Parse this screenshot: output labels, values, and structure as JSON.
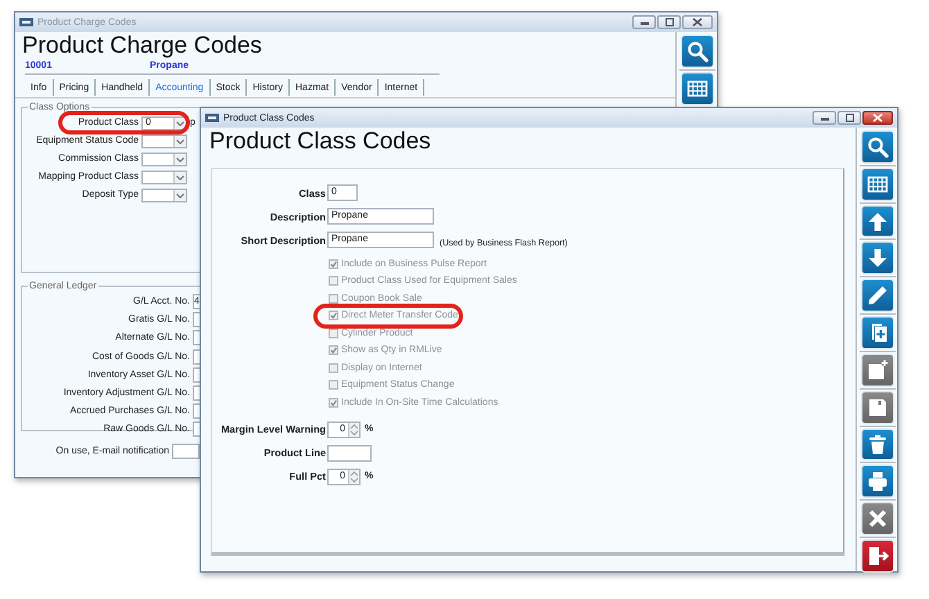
{
  "charge_window": {
    "title": "Product Charge Codes",
    "active": false,
    "heading": "Product Charge Codes",
    "code": "10001",
    "name": "Propane",
    "tabs": [
      {
        "label": "Info",
        "selected": false
      },
      {
        "label": "Pricing",
        "selected": false
      },
      {
        "label": "Handheld",
        "selected": false
      },
      {
        "label": "Accounting",
        "selected": true
      },
      {
        "label": "Stock",
        "selected": false
      },
      {
        "label": "History",
        "selected": false
      },
      {
        "label": "Hazmat",
        "selected": false
      },
      {
        "label": "Vendor",
        "selected": false
      },
      {
        "label": "Internet",
        "selected": false
      }
    ],
    "class_options": {
      "title": "Class Options",
      "fields": [
        {
          "label": "Product Class",
          "value": "0",
          "note": "p",
          "highlighted": true
        },
        {
          "label": "Equipment Status Code",
          "highlighted": false
        },
        {
          "label": "Commission Class",
          "highlighted": false
        },
        {
          "label": "Mapping Product Class",
          "highlighted": false
        },
        {
          "label": "Deposit Type",
          "highlighted": false
        }
      ]
    },
    "general_ledger": {
      "title": "General Ledger",
      "fields": [
        {
          "label": "G/L Acct. No.",
          "value": "4"
        },
        {
          "label": "Gratis G/L No."
        },
        {
          "label": "Alternate G/L No."
        },
        {
          "label": "Cost of Goods G/L No."
        },
        {
          "label": "Inventory Asset G/L No."
        },
        {
          "label": "Inventory Adjustment G/L No."
        },
        {
          "label": "Accrued Purchases G/L No."
        },
        {
          "label": "Raw Goods G/L No."
        }
      ]
    },
    "email_notification": {
      "label": "On use, E-mail notification"
    },
    "toolbar": [
      {
        "kind": "search",
        "disabled": false
      },
      {
        "kind": "grid",
        "disabled": false
      }
    ]
  },
  "class_window": {
    "title": "Product Class Codes",
    "active": true,
    "heading": "Product Class Codes",
    "fields": [
      {
        "label": "Class",
        "value": "0"
      },
      {
        "label": "Description",
        "value": "Propane"
      },
      {
        "label": "Short Description",
        "value": "Propane",
        "note": "(Used by Business Flash Report)"
      }
    ],
    "options": [
      {
        "label": "Include on Business Pulse Report",
        "checked": true,
        "disabled": true,
        "highlighted": false
      },
      {
        "label": "Product Class Used for Equipment Sales",
        "checked": false,
        "disabled": true,
        "highlighted": false
      },
      {
        "label": "Coupon Book Sale",
        "checked": false,
        "disabled": true,
        "highlighted": false
      },
      {
        "label": "Direct Meter Transfer Code",
        "checked": true,
        "disabled": true,
        "highlighted": true
      },
      {
        "label": "Cylinder Product",
        "checked": false,
        "disabled": true,
        "highlighted": false
      },
      {
        "label": "Show as Qty in RMLive",
        "checked": true,
        "disabled": true,
        "highlighted": false
      },
      {
        "label": "Display on Internet",
        "checked": false,
        "disabled": true,
        "highlighted": false
      },
      {
        "label": "Equipment Status Change",
        "checked": false,
        "disabled": true,
        "highlighted": false
      },
      {
        "label": "Include In On-Site Time Calculations",
        "checked": true,
        "disabled": true,
        "highlighted": false
      }
    ],
    "numeric_fields": [
      {
        "label": "Margin Level Warning",
        "kind": "spinner",
        "value": "0",
        "unit": "%"
      },
      {
        "label": "Product Line",
        "kind": "text"
      },
      {
        "label": "Full Pct",
        "kind": "spinner",
        "value": "0",
        "unit": "%"
      }
    ],
    "toolbar": [
      {
        "kind": "search",
        "disabled": false
      },
      {
        "kind": "grid",
        "disabled": false
      },
      {
        "kind": "up",
        "disabled": false
      },
      {
        "kind": "down",
        "disabled": false
      },
      {
        "kind": "edit",
        "disabled": false
      },
      {
        "kind": "add-page",
        "disabled": false
      },
      {
        "kind": "save-new",
        "disabled": true
      },
      {
        "kind": "save",
        "disabled": true
      },
      {
        "kind": "delete",
        "disabled": false
      },
      {
        "kind": "print",
        "disabled": false
      },
      {
        "kind": "cancel",
        "disabled": true
      },
      {
        "kind": "exit",
        "disabled": false
      }
    ]
  }
}
